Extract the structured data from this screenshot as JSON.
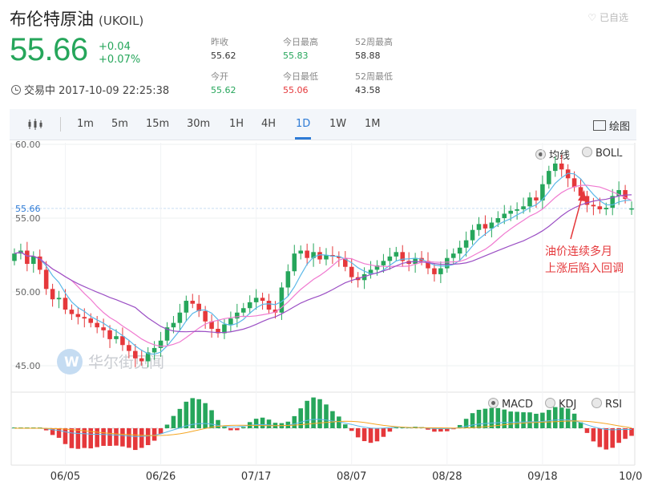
{
  "header": {
    "name": "布伦特原油",
    "symbol": "(UKOIL)",
    "favorite_label": "已自选",
    "price": "55.66",
    "change": "+0.04",
    "change_pct": "+0.07%",
    "status": "交易中 2017-10-09 22:25:38"
  },
  "stats": [
    {
      "label": "昨收",
      "value": "55.62",
      "tone": "neutral"
    },
    {
      "label": "今开",
      "value": "55.62",
      "tone": "up"
    },
    {
      "label": "今日最高",
      "value": "55.83",
      "tone": "up"
    },
    {
      "label": "今日最低",
      "value": "55.06",
      "tone": "down"
    },
    {
      "label": "52周最高",
      "value": "58.88",
      "tone": "neutral"
    },
    {
      "label": "52周最低",
      "value": "43.58",
      "tone": "neutral"
    }
  ],
  "toolbar": {
    "candle_icon": "candlestick-icon",
    "intervals": [
      "1m",
      "5m",
      "15m",
      "30m",
      "1H",
      "4H",
      "1D",
      "1W",
      "1M"
    ],
    "active_interval": "1D",
    "draw_label": "绘图"
  },
  "main_toggle": [
    {
      "label": "均线",
      "on": true
    },
    {
      "label": "BOLL",
      "on": false
    }
  ],
  "sub_toggle": [
    {
      "label": "MACD",
      "on": true
    },
    {
      "label": "KDJ",
      "on": false
    },
    {
      "label": "RSI",
      "on": false
    }
  ],
  "annotation": [
    "油价连续多月",
    "上涨后陷入回调"
  ],
  "watermark": "华尔街见闻",
  "colors": {
    "up": "#26a65b",
    "down": "#e5383b",
    "ma5": "#5bb8e8",
    "ma10": "#f07ad0",
    "ma20": "#9b4fc4",
    "accent": "#2e7bd6"
  },
  "chart_data": {
    "type": "candlestick",
    "ylim": [
      44,
      60.5
    ],
    "y_ticks": [
      "60.00",
      "55.00",
      "50.00",
      "45.00"
    ],
    "current_price_label": "55.66",
    "current_price": 55.66,
    "x_ticks": [
      "06/05",
      "06/26",
      "07/17",
      "08/07",
      "08/28",
      "09/18",
      "10/0"
    ],
    "closes": [
      52.6,
      52.8,
      51.9,
      52.4,
      51.5,
      50.2,
      49.5,
      49.6,
      48.8,
      48.5,
      48.3,
      48.2,
      47.9,
      47.6,
      47.4,
      46.8,
      47.0,
      46.4,
      46.0,
      45.5,
      45.3,
      45.9,
      46.2,
      46.7,
      47.6,
      47.9,
      48.6,
      49.4,
      49.2,
      48.7,
      48.0,
      47.5,
      47.2,
      47.8,
      48.2,
      48.6,
      48.9,
      49.3,
      49.6,
      49.4,
      48.8,
      48.6,
      50.3,
      51.4,
      52.6,
      52.8,
      52.3,
      52.7,
      52.2,
      52.5,
      52.4,
      52.3,
      51.7,
      51.0,
      50.8,
      51.2,
      51.5,
      51.8,
      52.1,
      52.4,
      52.7,
      52.1,
      51.9,
      52.3,
      52.1,
      51.6,
      51.2,
      51.6,
      52.3,
      52.6,
      53.0,
      53.5,
      54.2,
      54.6,
      54.3,
      54.7,
      55.0,
      55.3,
      55.5,
      55.6,
      55.8,
      56.4,
      56.2,
      57.3,
      58.2,
      58.7,
      58.3,
      57.7,
      57.1,
      56.5,
      55.9,
      55.8,
      55.6,
      55.7,
      56.5,
      56.9,
      56.3,
      55.66
    ],
    "opens": [
      52.1,
      52.6,
      52.8,
      51.9,
      52.4,
      51.5,
      50.2,
      49.5,
      49.6,
      48.8,
      48.5,
      48.3,
      48.2,
      47.9,
      47.6,
      47.4,
      46.8,
      47.0,
      46.4,
      46.0,
      45.5,
      45.3,
      45.9,
      46.2,
      46.7,
      47.6,
      47.9,
      48.6,
      49.4,
      49.2,
      48.7,
      48.0,
      47.5,
      47.2,
      47.8,
      48.2,
      48.6,
      48.9,
      49.3,
      49.6,
      49.4,
      48.8,
      48.6,
      50.3,
      51.4,
      52.6,
      52.8,
      52.3,
      52.7,
      52.2,
      52.5,
      52.4,
      52.3,
      51.7,
      51.0,
      50.8,
      51.2,
      51.5,
      51.8,
      52.1,
      52.4,
      52.7,
      52.1,
      51.9,
      52.3,
      52.1,
      51.6,
      51.2,
      51.6,
      52.3,
      52.6,
      53.0,
      53.5,
      54.2,
      54.6,
      54.3,
      54.7,
      55.0,
      55.3,
      55.5,
      55.6,
      55.8,
      56.4,
      56.2,
      57.3,
      58.2,
      58.7,
      58.3,
      57.7,
      57.1,
      56.5,
      55.9,
      55.8,
      55.6,
      55.7,
      56.5,
      56.9,
      55.62
    ]
  }
}
